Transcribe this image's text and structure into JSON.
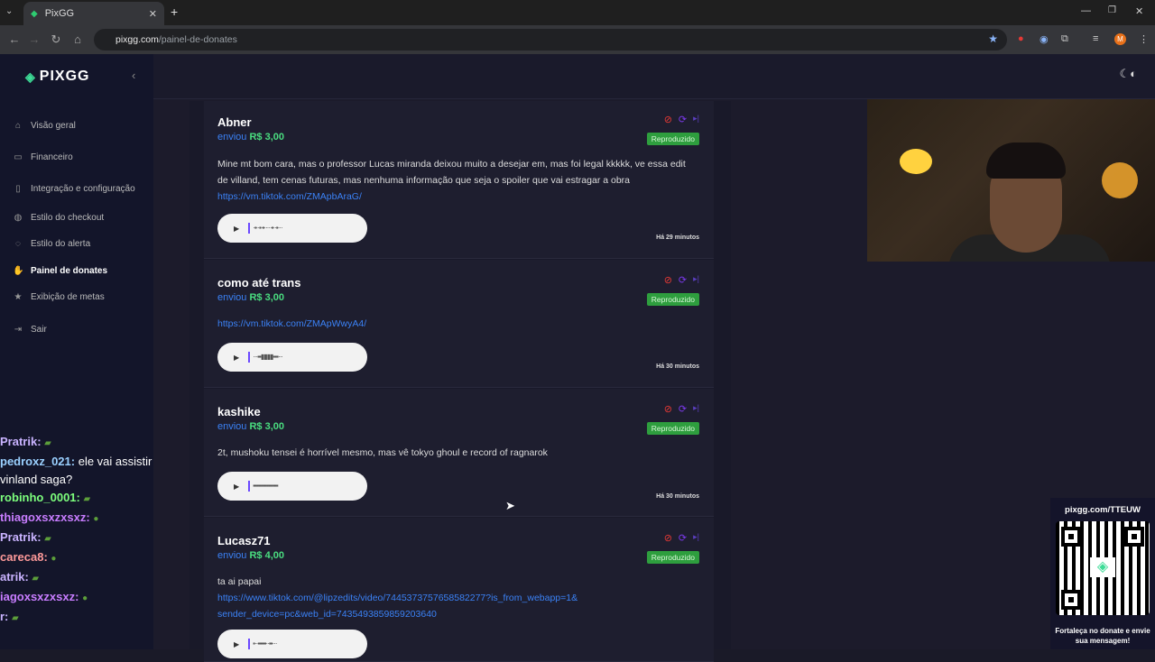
{
  "browser": {
    "tab_title": "PixGG",
    "url_domain": "pixgg.com",
    "url_path": "/painel-de-donates",
    "profile_initial": "M"
  },
  "sidebar": {
    "logo": "PIXGG",
    "items": [
      {
        "label": "Visão geral",
        "icon": "home-icon"
      },
      {
        "label": "Financeiro",
        "icon": "wallet-icon"
      },
      {
        "label": "Integração e configuração",
        "icon": "settings-icon"
      },
      {
        "label": "Estilo do checkout",
        "icon": "palette-icon"
      },
      {
        "label": "Estilo do alerta",
        "icon": "alert-icon"
      },
      {
        "label": "Painel de donates",
        "icon": "hand-icon"
      },
      {
        "label": "Exibição de metas",
        "icon": "star-icon"
      },
      {
        "label": "Sair",
        "icon": "logout-icon"
      }
    ]
  },
  "donations": [
    {
      "name": "Abner",
      "sent": "enviou",
      "amount": "R$ 3,00",
      "status": "Reproduzido",
      "message": "Mine mt bom cara, mas o professor Lucas miranda deixou muito a desejar em, mas foi legal kkkkk, ve essa edit de villand, tem cenas futuras, mas nenhuma informação que seja o spoiler que vai estragar a obra",
      "link": "https://vm.tiktok.com/ZMApbAraG/",
      "time": "Há 29 minutos"
    },
    {
      "name": "como até trans",
      "sent": "enviou",
      "amount": "R$ 3,00",
      "status": "Reproduzido",
      "message": "",
      "link": "https://vm.tiktok.com/ZMApWwyA4/",
      "time": "Há 30 minutos"
    },
    {
      "name": "kashike",
      "sent": "enviou",
      "amount": "R$ 3,00",
      "status": "Reproduzido",
      "message": "2t, mushoku tensei é horrível mesmo, mas vê tokyo ghoul e record of ragnarok",
      "link": "",
      "time": "Há 30 minutos"
    },
    {
      "name": "Lucasz71",
      "sent": "enviou",
      "amount": "R$ 4,00",
      "status": "Reproduzido",
      "message": "ta ai papai",
      "link": "https://www.tiktok.com/@lipzedits/video/7445373757658582277?is_from_webapp=1&sender_device=pc&web_id=7435493859859203640",
      "time": ""
    }
  ],
  "chat": [
    {
      "user": "Pratrik:",
      "text": "",
      "color": "#c9b3ff"
    },
    {
      "user": "pedroxz_021:",
      "text": "ele vai assistir vinland saga?",
      "color": "#9ad0ff"
    },
    {
      "user": "robinho_0001:",
      "text": "",
      "color": "#7dff7d"
    },
    {
      "user": "thiagoxsxzxsxz:",
      "text": "",
      "color": "#c87dff"
    },
    {
      "user": "Pratrik:",
      "text": "",
      "color": "#c9b3ff"
    },
    {
      "user": "careca8:",
      "text": "",
      "color": "#ff9a9a"
    },
    {
      "user": "atrik:",
      "text": "",
      "color": "#c9b3ff"
    },
    {
      "user": "iagoxsxzxsxz:",
      "text": "",
      "color": "#c87dff"
    },
    {
      "user": "r:",
      "text": "",
      "color": "#c9b3ff"
    }
  ],
  "qr": {
    "title": "pixgg.com/TTEUW",
    "caption": "Fortaleça no donate e envie sua mensagem!"
  }
}
